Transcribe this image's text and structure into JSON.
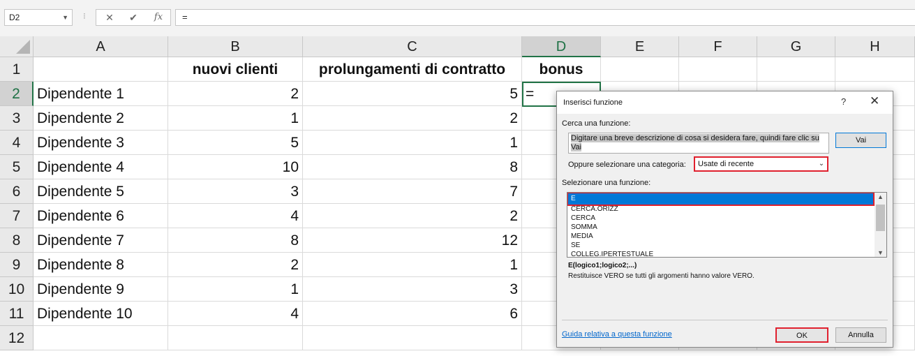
{
  "formula_bar": {
    "name_box": "D2",
    "cancel_symbol": "✕",
    "enter_symbol": "✔",
    "fx_symbol": "fx",
    "content": "="
  },
  "columns": [
    "A",
    "B",
    "C",
    "D",
    "E",
    "F",
    "G",
    "H"
  ],
  "selected_column": "D",
  "rows": [
    "1",
    "2",
    "3",
    "4",
    "5",
    "6",
    "7",
    "8",
    "9",
    "10",
    "11",
    "12"
  ],
  "selected_row": "2",
  "headers": {
    "b": "nuovi clienti",
    "c": "prolungamenti di contratto",
    "d": "bonus"
  },
  "table": [
    {
      "name": "Dipendente 1",
      "clienti": "2",
      "contratti": "5"
    },
    {
      "name": "Dipendente 2",
      "clienti": "1",
      "contratti": "2"
    },
    {
      "name": "Dipendente 3",
      "clienti": "5",
      "contratti": "1"
    },
    {
      "name": "Dipendente 4",
      "clienti": "10",
      "contratti": "8"
    },
    {
      "name": "Dipendente 5",
      "clienti": "3",
      "contratti": "7"
    },
    {
      "name": "Dipendente 6",
      "clienti": "4",
      "contratti": "2"
    },
    {
      "name": "Dipendente 7",
      "clienti": "8",
      "contratti": "12"
    },
    {
      "name": "Dipendente 8",
      "clienti": "2",
      "contratti": "1"
    },
    {
      "name": "Dipendente 9",
      "clienti": "1",
      "contratti": "3"
    },
    {
      "name": "Dipendente 10",
      "clienti": "4",
      "contratti": "6"
    }
  ],
  "active_cell_value": "=",
  "dialog": {
    "title": "Inserisci funzione",
    "help_symbol": "?",
    "close_symbol": "✕",
    "search_label": "Cerca una funzione:",
    "search_text": "Digitare una breve descrizione di cosa si desidera fare, quindi fare clic su Vai",
    "go_button": "Vai",
    "category_label": "Oppure selezionare una categoria:",
    "category_value": "Usate di recente",
    "function_label": "Selezionare una funzione:",
    "functions": [
      "E",
      "CERCA.ORIZZ",
      "CERCA",
      "SOMMA",
      "MEDIA",
      "SE",
      "COLLEG.IPERTESTUALE"
    ],
    "selected_function": "E",
    "signature": "E(logico1;logico2;...)",
    "description": "Restituisce VERO se tutti gli argomenti hanno valore VERO.",
    "help_link": "Guida relativa a questa funzione",
    "ok_button": "OK",
    "cancel_button": "Annulla"
  }
}
